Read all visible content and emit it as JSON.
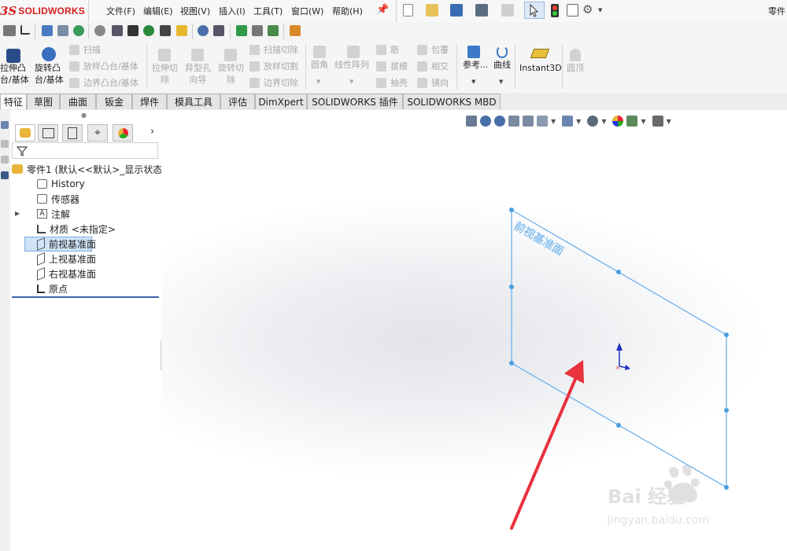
{
  "app": {
    "logo_mark": "3S",
    "logo_word": "SOLIDWORKS",
    "doc_title": "零件"
  },
  "menu": [
    "文件(F)",
    "编辑(E)",
    "视图(V)",
    "插入(I)",
    "工具(T)",
    "窗口(W)",
    "帮助(H)"
  ],
  "command_manager": {
    "extrude_boss": [
      "拉伸凸",
      "台/基体"
    ],
    "revolve_boss": [
      "旋转凸",
      "台/基体"
    ],
    "sweep": "扫描",
    "loft_boss": "放样凸台/基体",
    "boundary_boss": "边界凸台/基体",
    "extrude_cut": [
      "拉伸切",
      "除"
    ],
    "hole_wizard": [
      "异型孔",
      "向导"
    ],
    "revolve_cut": [
      "旋转切",
      "除"
    ],
    "swept_cut": "扫描切除",
    "lofted_cut": "放样切割",
    "boundary_cut": "边界切除",
    "fillet": "圆角",
    "linear_pattern": "线性阵列",
    "rib": "筋",
    "draft": "拔模",
    "shell": "抽壳",
    "wrap": "包覆",
    "intersect": "相交",
    "mirror": "镜向",
    "reference": "参考...",
    "curves": "曲线",
    "instant3d": "Instant3D",
    "dome": "圆顶"
  },
  "tabs": [
    "特征",
    "草图",
    "曲面",
    "钣金",
    "焊件",
    "模具工具",
    "评估",
    "DimXpert",
    "SOLIDWORKS 插件",
    "SOLIDWORKS MBD"
  ],
  "feature_tree": {
    "root": "零件1  (默认<<默认>_显示状态",
    "items": [
      {
        "label": "History",
        "icon": "history-folder-icon"
      },
      {
        "label": "传感器",
        "icon": "sensor-icon"
      },
      {
        "label": "注解",
        "icon": "annotation-icon"
      },
      {
        "label": "材质 <未指定>",
        "icon": "material-icon"
      },
      {
        "label": "前视基准面",
        "icon": "plane-icon",
        "selected": true
      },
      {
        "label": "上视基准面",
        "icon": "plane-icon"
      },
      {
        "label": "右视基准面",
        "icon": "plane-icon"
      },
      {
        "label": "原点",
        "icon": "origin-icon"
      }
    ]
  },
  "graphics": {
    "plane_label": "前视基准面"
  },
  "watermark": {
    "line1": "Bai 经验",
    "line2": "jingyan.baidu.com"
  },
  "colors": {
    "accent": "#d4201c",
    "plane": "#4a9fe0",
    "arrow": "#e8323c",
    "selection": "#cfe3f7"
  }
}
